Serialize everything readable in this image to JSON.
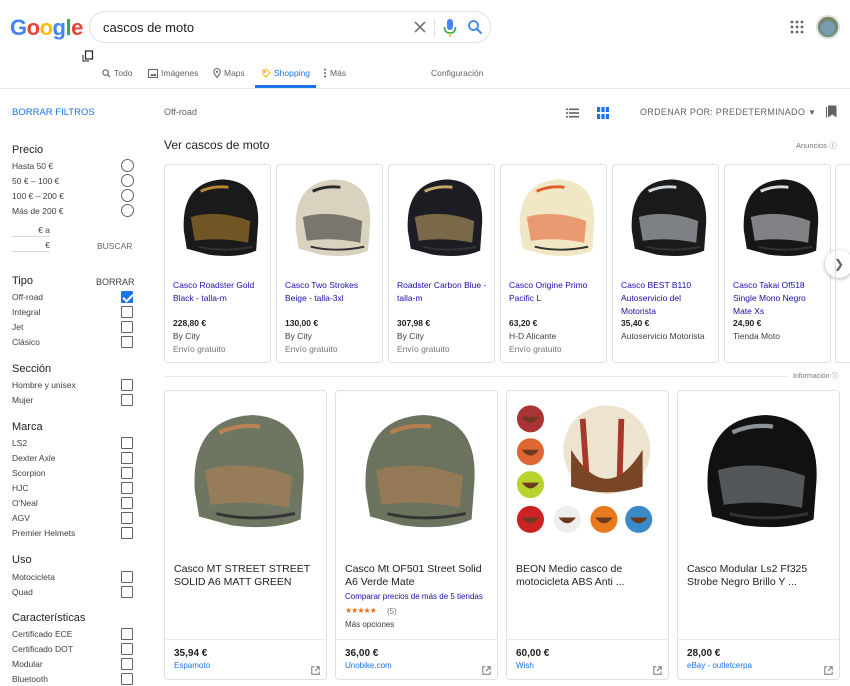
{
  "header": {
    "logo_letters": [
      {
        "ch": "G",
        "color": "#4285F4"
      },
      {
        "ch": "o",
        "color": "#EA4335"
      },
      {
        "ch": "o",
        "color": "#FBBC05"
      },
      {
        "ch": "g",
        "color": "#4285F4"
      },
      {
        "ch": "l",
        "color": "#34A853"
      },
      {
        "ch": "e",
        "color": "#EA4335"
      }
    ],
    "search_query": "cascos de moto"
  },
  "tabs": [
    {
      "label": "Todo",
      "icon": "search-icon"
    },
    {
      "label": "Imágenes",
      "icon": "image-icon"
    },
    {
      "label": "Maps",
      "icon": "map-pin-icon"
    },
    {
      "label": "Shopping",
      "icon": "tag-icon",
      "active": true
    },
    {
      "label": "Más",
      "icon": "more-vert-icon"
    },
    {
      "label": "Configuración"
    }
  ],
  "sidebar": {
    "clear_filters": "BORRAR FILTROS",
    "price": {
      "title": "Precio",
      "options": [
        "Hasta 50 €",
        "50 € – 100 €",
        "100 € – 200 €",
        "Más de 200 €"
      ],
      "from_suffix": "€ a",
      "to_suffix": "€",
      "go_label": "BUSCAR"
    },
    "type": {
      "title": "Tipo",
      "clear_label": "BORRAR",
      "options": [
        {
          "label": "Off-road",
          "checked": true
        },
        {
          "label": "Integral",
          "checked": false
        },
        {
          "label": "Jet",
          "checked": false
        },
        {
          "label": "Clásico",
          "checked": false
        }
      ]
    },
    "section": {
      "title": "Sección",
      "options": [
        "Hombre y unisex",
        "Mujer"
      ]
    },
    "brand": {
      "title": "Marca",
      "options": [
        "LS2",
        "Dexter Axle",
        "Scorpion",
        "HJC",
        "O'Neal",
        "AGV",
        "Premier Helmets"
      ]
    },
    "use": {
      "title": "Uso",
      "options": [
        "Motocicleta",
        "Quad"
      ]
    },
    "features": {
      "title": "Características",
      "options": [
        "Certificado ECE",
        "Certificado DOT",
        "Modular",
        "Bluetooth"
      ]
    }
  },
  "toolbar": {
    "breadcrumb": "Off-road",
    "sort_label": "ORDENAR POR: PREDETERMINADO",
    "list_view_icon": "list-view-icon",
    "grid_view_icon": "grid-view-icon",
    "saved_icon": "bookmark-icon"
  },
  "carousel": {
    "title": "Ver cascos de moto",
    "ads_label": "Anuncios",
    "items": [
      {
        "title": "Casco Roadster Gold Black - talla-m",
        "price": "228,80 €",
        "store": "By City",
        "shipping": "Envío gratuito",
        "colors": [
          "#1a1a1a",
          "#b8892f"
        ]
      },
      {
        "title": "Casco Two Strokes Beige - talla-3xl",
        "price": "130,00 €",
        "store": "By City",
        "shipping": "Envío gratuito",
        "colors": [
          "#d9d2bf",
          "#2a2a2a"
        ]
      },
      {
        "title": "Roadster Carbon Blue - talla-m",
        "price": "307,98 €",
        "store": "By City",
        "shipping": "Envío gratuito",
        "colors": [
          "#1c1d22",
          "#c9a86a"
        ]
      },
      {
        "title": "Casco Origine Primo Pacific L",
        "price": "63,20 €",
        "store": "H-D Alicante",
        "shipping": "Envío gratuito",
        "colors": [
          "#f1e7c5",
          "#e25b2b"
        ]
      },
      {
        "title": "Casco BEST B110 Autoservicio del Motorista",
        "price": "35,40 €",
        "store": "Autoservicio Motorista",
        "shipping": "",
        "colors": [
          "#1a1a1a",
          "#cfd6dc"
        ]
      },
      {
        "title": "Casco Takai Of518 Single Mono Negro Mate Xs",
        "price": "24,90 €",
        "store": "Tienda Moto",
        "shipping": "",
        "colors": [
          "#161616",
          "#d8dde2"
        ]
      }
    ]
  },
  "info_label": "Información",
  "products": [
    {
      "title": "Casco MT STREET STREET SOLID A6 MATT GREEN",
      "compare": "",
      "stars": "",
      "reviews": "",
      "more": "",
      "price": "35,94 €",
      "store": "Espamoto",
      "colors": [
        "#6e7661",
        "#b98253"
      ]
    },
    {
      "title": "Casco Mt OF501 Street Solid A6 Verde Mate",
      "compare": "Comparar precios de más de 5 tiendas",
      "stars": "★★★★★",
      "reviews": "(5)",
      "more": "Más opciones",
      "price": "36,00 €",
      "store": "Unobike.com",
      "colors": [
        "#6b735e",
        "#b57e4f"
      ]
    },
    {
      "title": "BEON Medio casco de motocicleta ABS Anti ...",
      "compare": "",
      "stars": "",
      "reviews": "",
      "more": "",
      "price": "60,00 €",
      "store": "Wish",
      "colors": [
        "#ede4cf",
        "#a6392b"
      ]
    },
    {
      "title": "Casco Modular Ls2 Ff325 Strobe Negro Brillo Y ...",
      "compare": "",
      "stars": "",
      "reviews": "",
      "more": "",
      "price": "28,00 €",
      "store": "eBay - outletcerpa",
      "colors": [
        "#111111",
        "#8b9298"
      ]
    }
  ]
}
